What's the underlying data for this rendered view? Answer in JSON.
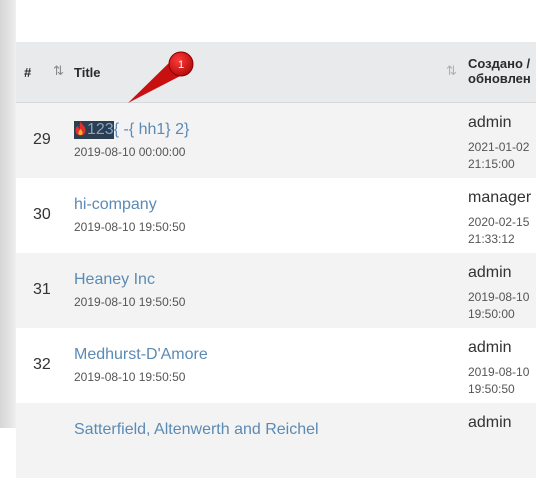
{
  "header": {
    "hash": "#",
    "sort_icon": "⇅",
    "title": "Title",
    "created_line1": "Создано /",
    "created_line2": "обновлен"
  },
  "callout": {
    "number": "1"
  },
  "rows": [
    {
      "num": "29",
      "title_highlight": "123",
      "title_rest": "{ -{ hh1} 2}",
      "date": "2019-08-10 00:00:00",
      "user": "admin",
      "cdate1": "2021-01-02",
      "cdate2": "21:15:00"
    },
    {
      "num": "30",
      "title": "hi-company",
      "date": "2019-08-10 19:50:50",
      "user": "manager",
      "cdate1": "2020-02-15",
      "cdate2": "21:33:12"
    },
    {
      "num": "31",
      "title": "Heaney Inc",
      "date": "2019-08-10 19:50:50",
      "user": "admin",
      "cdate1": "2019-08-10",
      "cdate2": "19:50:00"
    },
    {
      "num": "32",
      "title": "Medhurst-D'Amore",
      "date": "2019-08-10 19:50:50",
      "user": "admin",
      "cdate1": "2019-08-10",
      "cdate2": "19:50:50"
    },
    {
      "num": "",
      "title": "Satterfield, Altenwerth and Reichel",
      "date": "",
      "user": "admin",
      "cdate1": "",
      "cdate2": ""
    }
  ]
}
